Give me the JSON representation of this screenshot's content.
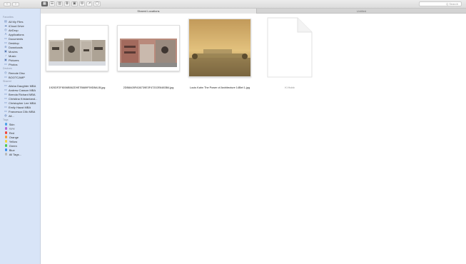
{
  "toolbar": {
    "back": "‹",
    "forward": "›",
    "view_buttons": [
      "▦",
      "☰",
      "▥",
      "⧉",
      "▣",
      "⚙",
      "↗",
      "◯"
    ],
    "search_placeholder": "Q Search"
  },
  "tabs": [
    {
      "label": "Shared Locations"
    },
    {
      "label": "Untitled"
    }
  ],
  "sidebar": {
    "sections": [
      {
        "header": "Favorites",
        "items": [
          {
            "label": "All My Files",
            "icon": "all-files-icon",
            "glyph": "▤"
          },
          {
            "label": "iCloud Drive",
            "icon": "cloud-icon",
            "glyph": "☁"
          },
          {
            "label": "AirDrop",
            "icon": "airdrop-icon",
            "glyph": "◎"
          },
          {
            "label": "Applications",
            "icon": "applications-icon",
            "glyph": "A"
          },
          {
            "label": "Documents",
            "icon": "documents-icon",
            "glyph": "▭"
          },
          {
            "label": "Desktop",
            "icon": "desktop-icon",
            "glyph": "▭"
          },
          {
            "label": "Downloads",
            "icon": "downloads-icon",
            "glyph": "⊕"
          },
          {
            "label": "Movies",
            "icon": "movies-icon",
            "glyph": "▣"
          },
          {
            "label": "Music",
            "icon": "music-icon",
            "glyph": "♪"
          },
          {
            "label": "Pictures",
            "icon": "pictures-icon",
            "glyph": "▣"
          },
          {
            "label": "Photos",
            "icon": "photos-icon",
            "glyph": "▭"
          }
        ]
      },
      {
        "header": "Devices",
        "items": [
          {
            "label": "Remote Disc",
            "icon": "disc-icon",
            "glyph": "◎"
          },
          {
            "label": "BOOTCAMP",
            "icon": "drive-icon",
            "glyph": "▭"
          }
        ]
      },
      {
        "header": "Shared",
        "items": [
          {
            "label": "Alisha Daughter MBA",
            "icon": "computer-icon",
            "glyph": "▭"
          },
          {
            "label": "Andrew Casson MBA",
            "icon": "computer-icon",
            "glyph": "▭"
          },
          {
            "label": "Brenda Richard MBA",
            "icon": "computer-icon",
            "glyph": "▭"
          },
          {
            "label": "Christina Kristantand...",
            "icon": "computer-icon",
            "glyph": "▭"
          },
          {
            "label": "Christopher Lee MBA",
            "icon": "computer-icon",
            "glyph": "▭"
          },
          {
            "label": "Emily Haust MBA",
            "icon": "computer-icon",
            "glyph": "▭"
          },
          {
            "label": "Francesca Cillo MBA",
            "icon": "computer-icon",
            "glyph": "▭"
          },
          {
            "label": "All...",
            "icon": "globe-icon",
            "glyph": "◍"
          }
        ]
      }
    ],
    "tags_header": "Tags",
    "tags": [
      {
        "label": "Skin",
        "color": "#4aa0e8"
      },
      {
        "label": "YYY",
        "color": "#b066d8"
      },
      {
        "label": "Red",
        "color": "#f0443a"
      },
      {
        "label": "Orange",
        "color": "#f5a030"
      },
      {
        "label": "Yellow",
        "color": "#f2d23c"
      },
      {
        "label": "Green",
        "color": "#4cc751"
      },
      {
        "label": "Blue",
        "color": "#3b8ff0"
      },
      {
        "label": "All Tags...",
        "color": "#b9b9b9"
      }
    ]
  },
  "files": [
    {
      "name": "1920DF2F8006B562D9E7B689F59DBA1B.jpg"
    },
    {
      "name": "2DB8A05FA36739E3F47202E6483B4.jpg"
    },
    {
      "name": "Louis Kahn The Power of Architecture 14Bet 1.jpg"
    },
    {
      "name": "Ki Hobb"
    }
  ]
}
